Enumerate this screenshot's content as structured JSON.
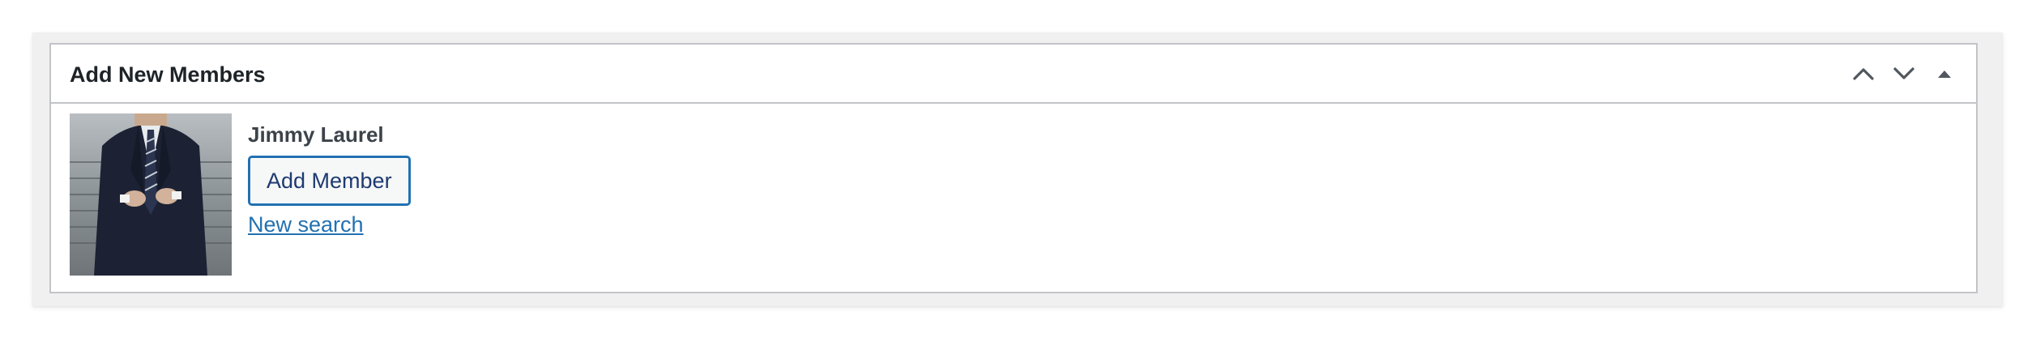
{
  "postbox": {
    "title": "Add New Members",
    "handle_icons": [
      "chevron-up-icon",
      "chevron-down-icon",
      "triangle-up-icon"
    ]
  },
  "member": {
    "name": "Jimmy Laurel",
    "avatar_icon": "member-photo"
  },
  "actions": {
    "add_member_label": "Add Member",
    "new_search_label": "New search"
  },
  "colors": {
    "accent": "#2271b1",
    "title_text": "#1d2327",
    "border": "#c3c4c7",
    "outer_bg": "#f0f0f1"
  }
}
